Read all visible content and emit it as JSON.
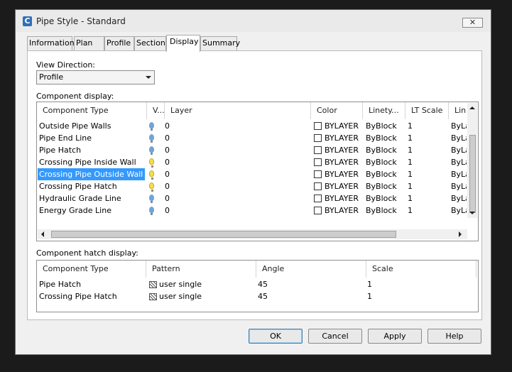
{
  "window": {
    "title": "Pipe Style - Standard",
    "close_label": "✕"
  },
  "tabs": [
    "Information",
    "Plan",
    "Profile",
    "Section",
    "Display",
    "Summary"
  ],
  "active_tab": "Display",
  "view_direction": {
    "label": "View Direction:",
    "value": "Profile"
  },
  "component_display": {
    "label": "Component display:",
    "columns": [
      "Component Type",
      "V...",
      "Layer",
      "Color",
      "Linety...",
      "LT Scale",
      "Lin"
    ],
    "rows": [
      {
        "name": "Outside Pipe Walls",
        "visible": "off",
        "layer": "0",
        "color": "BYLAYER",
        "linetype": "ByBlock",
        "lt_scale": "1",
        "lineweight": "ByLa"
      },
      {
        "name": "Pipe End Line",
        "visible": "off",
        "layer": "0",
        "color": "BYLAYER",
        "linetype": "ByBlock",
        "lt_scale": "1",
        "lineweight": "ByLa"
      },
      {
        "name": "Pipe Hatch",
        "visible": "off",
        "layer": "0",
        "color": "BYLAYER",
        "linetype": "ByBlock",
        "lt_scale": "1",
        "lineweight": "ByLa"
      },
      {
        "name": "Crossing Pipe Inside Wall",
        "visible": "on",
        "layer": "0",
        "color": "BYLAYER",
        "linetype": "ByBlock",
        "lt_scale": "1",
        "lineweight": "ByLa"
      },
      {
        "name": "Crossing Pipe Outside Wall",
        "visible": "on",
        "layer": "0",
        "color": "BYLAYER",
        "linetype": "ByBlock",
        "lt_scale": "1",
        "lineweight": "ByLa",
        "selected": true
      },
      {
        "name": "Crossing Pipe Hatch",
        "visible": "on",
        "layer": "0",
        "color": "BYLAYER",
        "linetype": "ByBlock",
        "lt_scale": "1",
        "lineweight": "ByLa"
      },
      {
        "name": "Hydraulic Grade Line",
        "visible": "off",
        "layer": "0",
        "color": "BYLAYER",
        "linetype": "ByBlock",
        "lt_scale": "1",
        "lineweight": "ByLa"
      },
      {
        "name": "Energy Grade Line",
        "visible": "off",
        "layer": "0",
        "color": "BYLAYER",
        "linetype": "ByBlock",
        "lt_scale": "1",
        "lineweight": "ByLa"
      }
    ]
  },
  "component_hatch_display": {
    "label": "Component hatch display:",
    "columns": [
      "Component Type",
      "Pattern",
      "Angle",
      "Scale"
    ],
    "rows": [
      {
        "name": "Pipe Hatch",
        "pattern": "user single",
        "angle": "45",
        "scale": "1"
      },
      {
        "name": "Crossing Pipe Hatch",
        "pattern": "user single",
        "angle": "45",
        "scale": "1"
      }
    ]
  },
  "buttons": {
    "ok": "OK",
    "cancel": "Cancel",
    "apply": "Apply",
    "help": "Help"
  },
  "colors": {
    "selection": "#3399ff",
    "bulb_on": "#f4df4e",
    "bulb_off": "#6fa5d8",
    "default_button_border": "#3c7fb1"
  },
  "icons": {
    "app": "civil-3d-c-icon",
    "visibility_on": "lightbulb-on-icon",
    "visibility_off": "lightbulb-off-icon",
    "pattern": "hatch-pattern-icon"
  }
}
